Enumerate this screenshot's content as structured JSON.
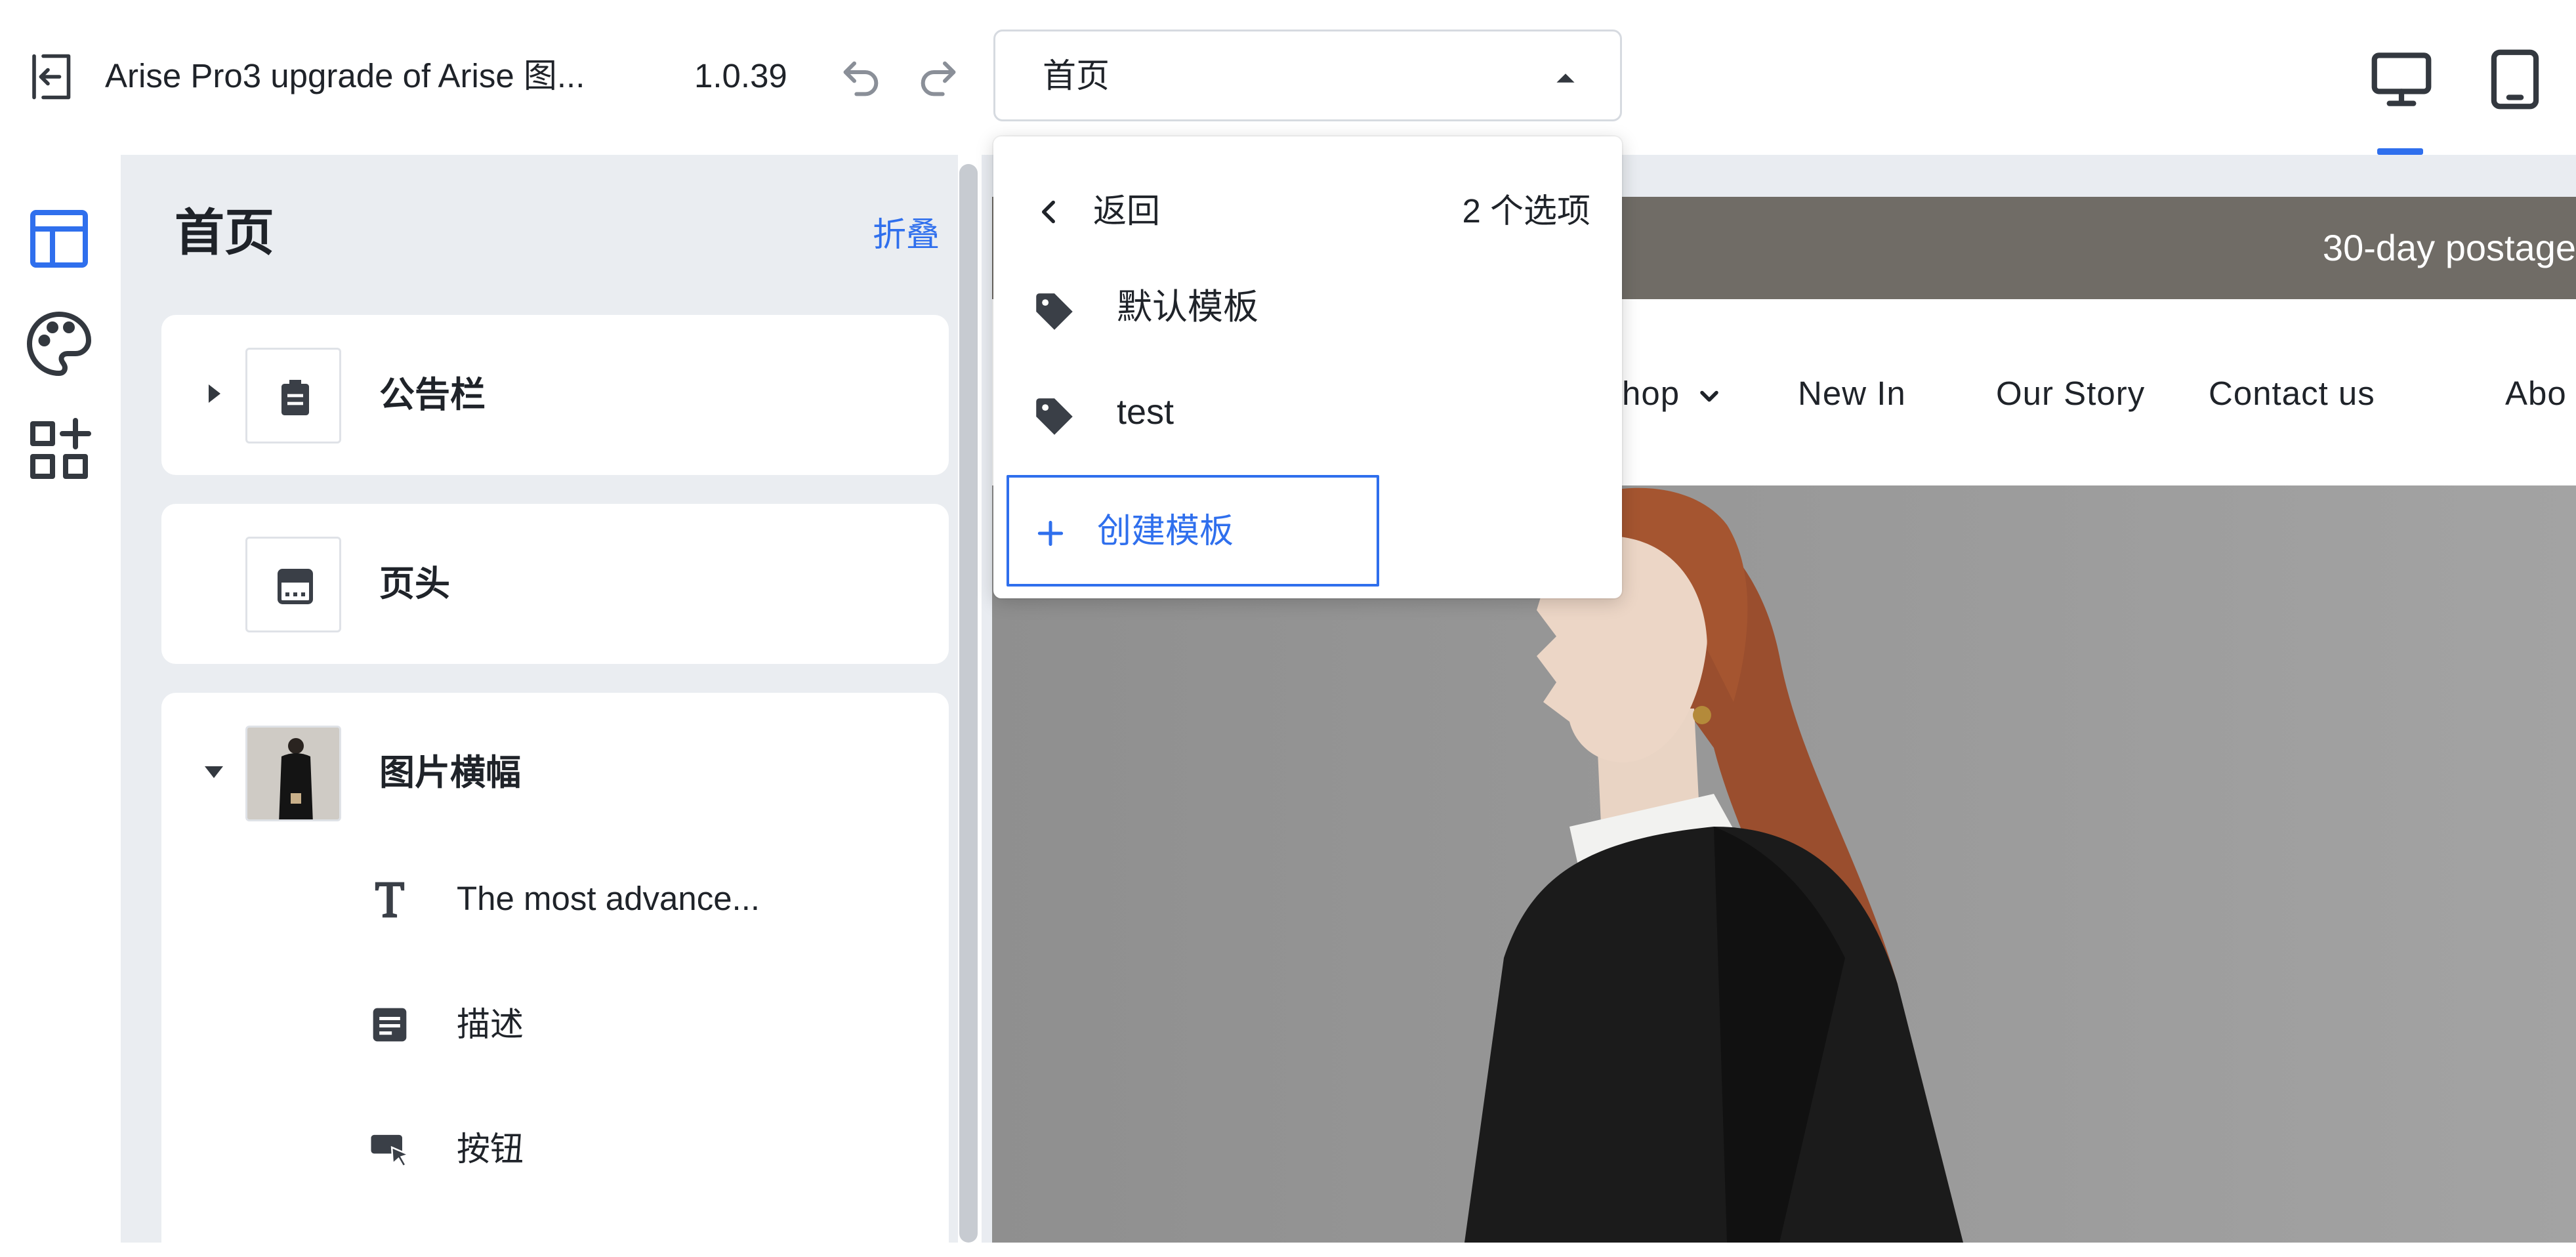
{
  "topbar": {
    "app_title": "Arise Pro3 upgrade of Arise 图...",
    "version": "1.0.39",
    "page_selector_value": "首页"
  },
  "dropdown": {
    "back_label": "返回",
    "options_count": "2 个选项",
    "items": [
      {
        "label": "默认模板",
        "icon": "tag-icon"
      },
      {
        "label": "test",
        "icon": "tag-icon"
      }
    ],
    "create_label": "创建模板"
  },
  "panel": {
    "title": "首页",
    "collapse_label": "折叠",
    "sections": [
      {
        "label": "公告栏",
        "icon": "clipboard-icon",
        "expanded": false
      },
      {
        "label": "页头",
        "icon": "header-layout-icon"
      },
      {
        "label": "图片横幅",
        "icon": "image-thumbnail",
        "expanded": true,
        "children": [
          {
            "label": "The most advance...",
            "icon": "text-icon"
          },
          {
            "label": "描述",
            "icon": "paragraph-icon"
          },
          {
            "label": "按钮",
            "icon": "button-click-icon"
          }
        ]
      }
    ]
  },
  "preview": {
    "announcement_text": "30-day postage",
    "nav": [
      "hop",
      "New In",
      "Our Story",
      "Contact us",
      "Abo"
    ]
  },
  "colors": {
    "accent": "#2f6fed",
    "announcement_bg": "#706c66",
    "panel_bg": "#eaedf1"
  }
}
